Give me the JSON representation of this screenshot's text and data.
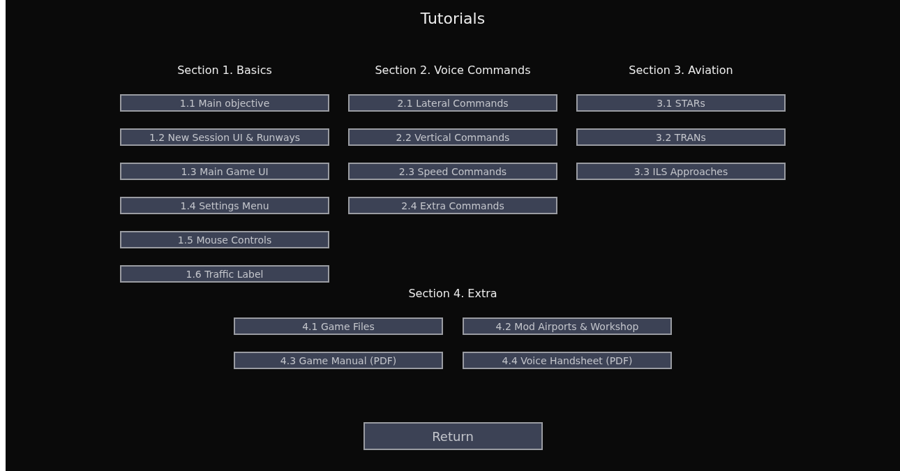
{
  "title": "Tutorials",
  "sections": [
    {
      "heading": "Section 1. Basics",
      "buttons": [
        "1.1 Main objective",
        "1.2 New Session UI & Runways",
        "1.3 Main Game UI",
        "1.4 Settings Menu",
        "1.5 Mouse Controls",
        "1.6 Traffic Label"
      ]
    },
    {
      "heading": "Section 2. Voice Commands",
      "buttons": [
        "2.1 Lateral Commands",
        "2.2 Vertical Commands",
        "2.3 Speed Commands",
        "2.4 Extra Commands"
      ]
    },
    {
      "heading": "Section 3. Aviation",
      "buttons": [
        "3.1 STARs",
        "3.2 TRANs",
        "3.3 ILS Approaches"
      ]
    }
  ],
  "extra_section": {
    "heading": "Section 4. Extra",
    "buttons": [
      "4.1 Game Files",
      "4.2 Mod Airports & Workshop",
      "4.3 Game Manual (PDF)",
      "4.4 Voice Handsheet (PDF)"
    ]
  },
  "return_button": "Return"
}
